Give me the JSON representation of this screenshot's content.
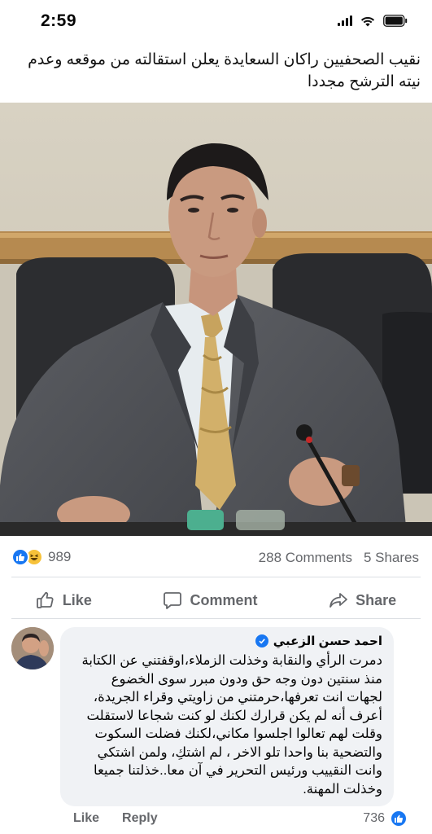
{
  "status_bar": {
    "time": "2:59"
  },
  "post": {
    "title": "نقيب الصحفيين راكان السعايدة يعلن استقالته من موقعه وعدم نيته الترشح مجددا"
  },
  "counts": {
    "reactions_total": "989",
    "comments": "288 Comments",
    "shares": "5 Shares"
  },
  "actions": {
    "like": "Like",
    "comment": "Comment",
    "share": "Share"
  },
  "comment": {
    "author": "احمد حسن الزعبي",
    "text": "دمرت الرأي والنقابة وخذلت الزملاء،اوقفتني عن الكتابة\nمنذ سنتين دون وجه حق ودون مبرر سوى الخضوع\nلجهات انت تعرفها،حرمتني من زاويتي وقراء الجريدة،\nأعرف أنه لم يكن قرارك لكنك لو كنت شجاعا لاستقلت\nوقلت لهم  تعالوا اجلسوا مكاني،لكنك فضلت السكوت\nوالتضحية بنا واحدا تلو الاخر ، لم اشتكِ، ولمن اشتكي\nوانت النقييب ورئيس التحرير في آن معا..خذلتنا جميعا\nوخذلت المهنة.",
    "like_label": "Like",
    "reply_label": "Reply",
    "reaction_count": "736"
  },
  "colors": {
    "accent": "#1877f2",
    "muted_text": "#65676b",
    "bubble_bg": "#f0f2f5"
  }
}
